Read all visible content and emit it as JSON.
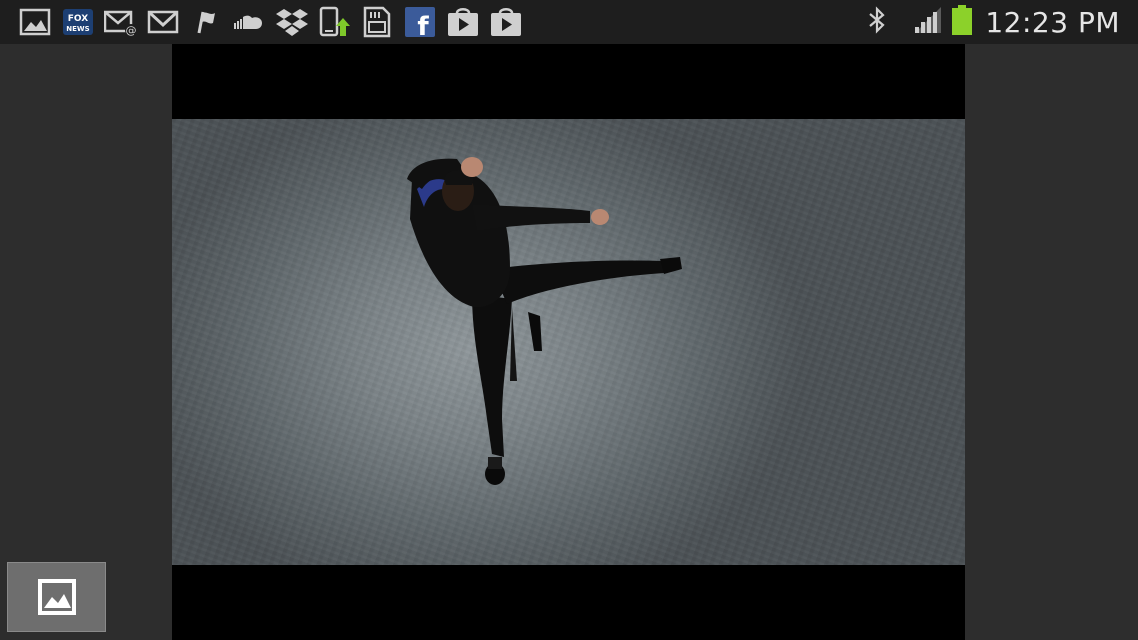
{
  "status_bar": {
    "time": "12:23 PM",
    "notification_icons": [
      "gallery-icon",
      "fox-news-icon",
      "email-icon",
      "gmail-icon",
      "flag-icon",
      "soundcloud-icon",
      "dropbox-icon",
      "phone-update-icon",
      "sd-card-icon",
      "facebook-icon",
      "play-store-icon",
      "play-store-icon"
    ],
    "fox_news_label": "FOX NEWS",
    "facebook_label": "f",
    "battery_color": "#8cd12a",
    "system_icons": [
      "bluetooth-icon",
      "signal-icon",
      "battery-icon"
    ]
  },
  "video": {
    "background": "#000000"
  },
  "thumbnail_button": {
    "icon": "gallery-icon"
  }
}
